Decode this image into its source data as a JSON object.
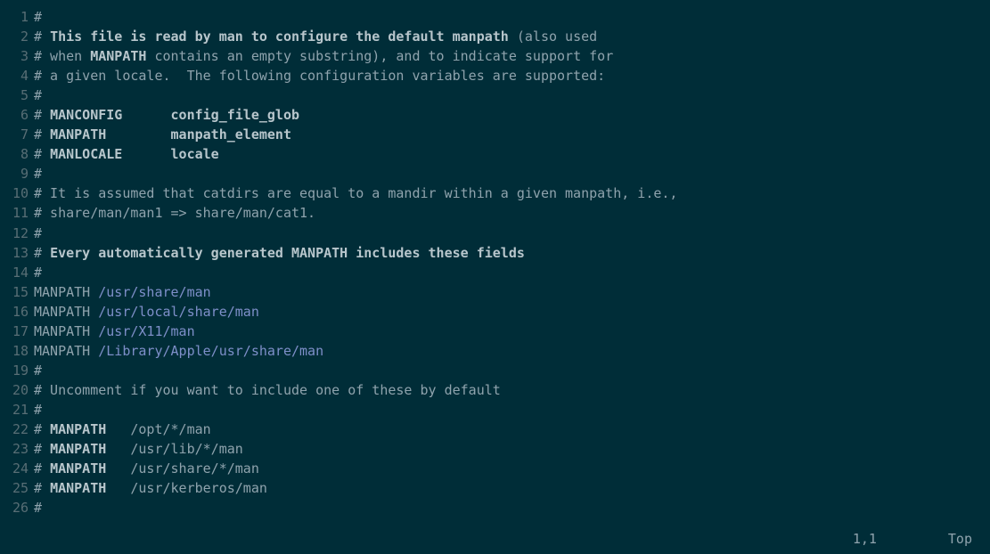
{
  "lines": [
    {
      "n": "1",
      "segments": [
        {
          "cls": "comment",
          "text": "#"
        }
      ]
    },
    {
      "n": "2",
      "segments": [
        {
          "cls": "comment",
          "text": "# "
        },
        {
          "cls": "comment-bold",
          "text": "This file is read by man to configure the default manpath "
        },
        {
          "cls": "comment",
          "text": "(also used"
        }
      ]
    },
    {
      "n": "3",
      "segments": [
        {
          "cls": "comment",
          "text": "# when "
        },
        {
          "cls": "comment-bold",
          "text": "MANPATH"
        },
        {
          "cls": "comment",
          "text": " contains an empty substring), and to indicate support for"
        }
      ]
    },
    {
      "n": "4",
      "segments": [
        {
          "cls": "comment",
          "text": "# a given locale.  The following configuration variables are supported:"
        }
      ]
    },
    {
      "n": "5",
      "segments": [
        {
          "cls": "comment",
          "text": "#"
        }
      ]
    },
    {
      "n": "6",
      "segments": [
        {
          "cls": "comment",
          "text": "# "
        },
        {
          "cls": "comment-bold",
          "text": "MANCONFIG"
        },
        {
          "cls": "comment",
          "text": "      "
        },
        {
          "cls": "comment-bold",
          "text": "config_file_glob"
        }
      ]
    },
    {
      "n": "7",
      "segments": [
        {
          "cls": "comment",
          "text": "# "
        },
        {
          "cls": "comment-bold",
          "text": "MANPATH"
        },
        {
          "cls": "comment",
          "text": "        "
        },
        {
          "cls": "comment-bold",
          "text": "manpath_element"
        }
      ]
    },
    {
      "n": "8",
      "segments": [
        {
          "cls": "comment",
          "text": "# "
        },
        {
          "cls": "comment-bold",
          "text": "MANLOCALE"
        },
        {
          "cls": "comment",
          "text": "      "
        },
        {
          "cls": "comment-bold",
          "text": "locale"
        }
      ]
    },
    {
      "n": "9",
      "segments": [
        {
          "cls": "comment",
          "text": "#"
        }
      ]
    },
    {
      "n": "10",
      "segments": [
        {
          "cls": "comment",
          "text": "# It is assumed that catdirs are equal to a mandir within a given manpath, i.e.,"
        }
      ]
    },
    {
      "n": "11",
      "segments": [
        {
          "cls": "comment",
          "text": "# share/man/man1 => share/man/cat1."
        }
      ]
    },
    {
      "n": "12",
      "segments": [
        {
          "cls": "comment",
          "text": "#"
        }
      ]
    },
    {
      "n": "13",
      "segments": [
        {
          "cls": "comment",
          "text": "# "
        },
        {
          "cls": "comment-bold",
          "text": "Every automatically generated MANPATH includes these fields"
        }
      ]
    },
    {
      "n": "14",
      "segments": [
        {
          "cls": "comment",
          "text": "#"
        }
      ]
    },
    {
      "n": "15",
      "segments": [
        {
          "cls": "keyword",
          "text": "MANPATH "
        },
        {
          "cls": "path",
          "text": "/usr/share/man"
        }
      ]
    },
    {
      "n": "16",
      "segments": [
        {
          "cls": "keyword",
          "text": "MANPATH "
        },
        {
          "cls": "path",
          "text": "/usr/local/share/man"
        }
      ]
    },
    {
      "n": "17",
      "segments": [
        {
          "cls": "keyword",
          "text": "MANPATH "
        },
        {
          "cls": "path",
          "text": "/usr/X11/man"
        }
      ]
    },
    {
      "n": "18",
      "segments": [
        {
          "cls": "keyword",
          "text": "MANPATH "
        },
        {
          "cls": "path",
          "text": "/Library/Apple/usr/share/man"
        }
      ]
    },
    {
      "n": "19",
      "segments": [
        {
          "cls": "comment",
          "text": "#"
        }
      ]
    },
    {
      "n": "20",
      "segments": [
        {
          "cls": "comment",
          "text": "# Uncomment if you want to include one of these by default"
        }
      ]
    },
    {
      "n": "21",
      "segments": [
        {
          "cls": "comment",
          "text": "#"
        }
      ]
    },
    {
      "n": "22",
      "segments": [
        {
          "cls": "comment",
          "text": "# "
        },
        {
          "cls": "comment-bold",
          "text": "MANPATH"
        },
        {
          "cls": "comment",
          "text": "   /opt/*/man"
        }
      ]
    },
    {
      "n": "23",
      "segments": [
        {
          "cls": "comment",
          "text": "# "
        },
        {
          "cls": "comment-bold",
          "text": "MANPATH"
        },
        {
          "cls": "comment",
          "text": "   /usr/lib/*/man"
        }
      ]
    },
    {
      "n": "24",
      "segments": [
        {
          "cls": "comment",
          "text": "# "
        },
        {
          "cls": "comment-bold",
          "text": "MANPATH"
        },
        {
          "cls": "comment",
          "text": "   /usr/share/*/man"
        }
      ]
    },
    {
      "n": "25",
      "segments": [
        {
          "cls": "comment",
          "text": "# "
        },
        {
          "cls": "comment-bold",
          "text": "MANPATH"
        },
        {
          "cls": "comment",
          "text": "   /usr/kerberos/man"
        }
      ]
    },
    {
      "n": "26",
      "segments": [
        {
          "cls": "comment",
          "text": "#"
        }
      ]
    }
  ],
  "status": {
    "position": "1,1",
    "scroll": "Top"
  }
}
